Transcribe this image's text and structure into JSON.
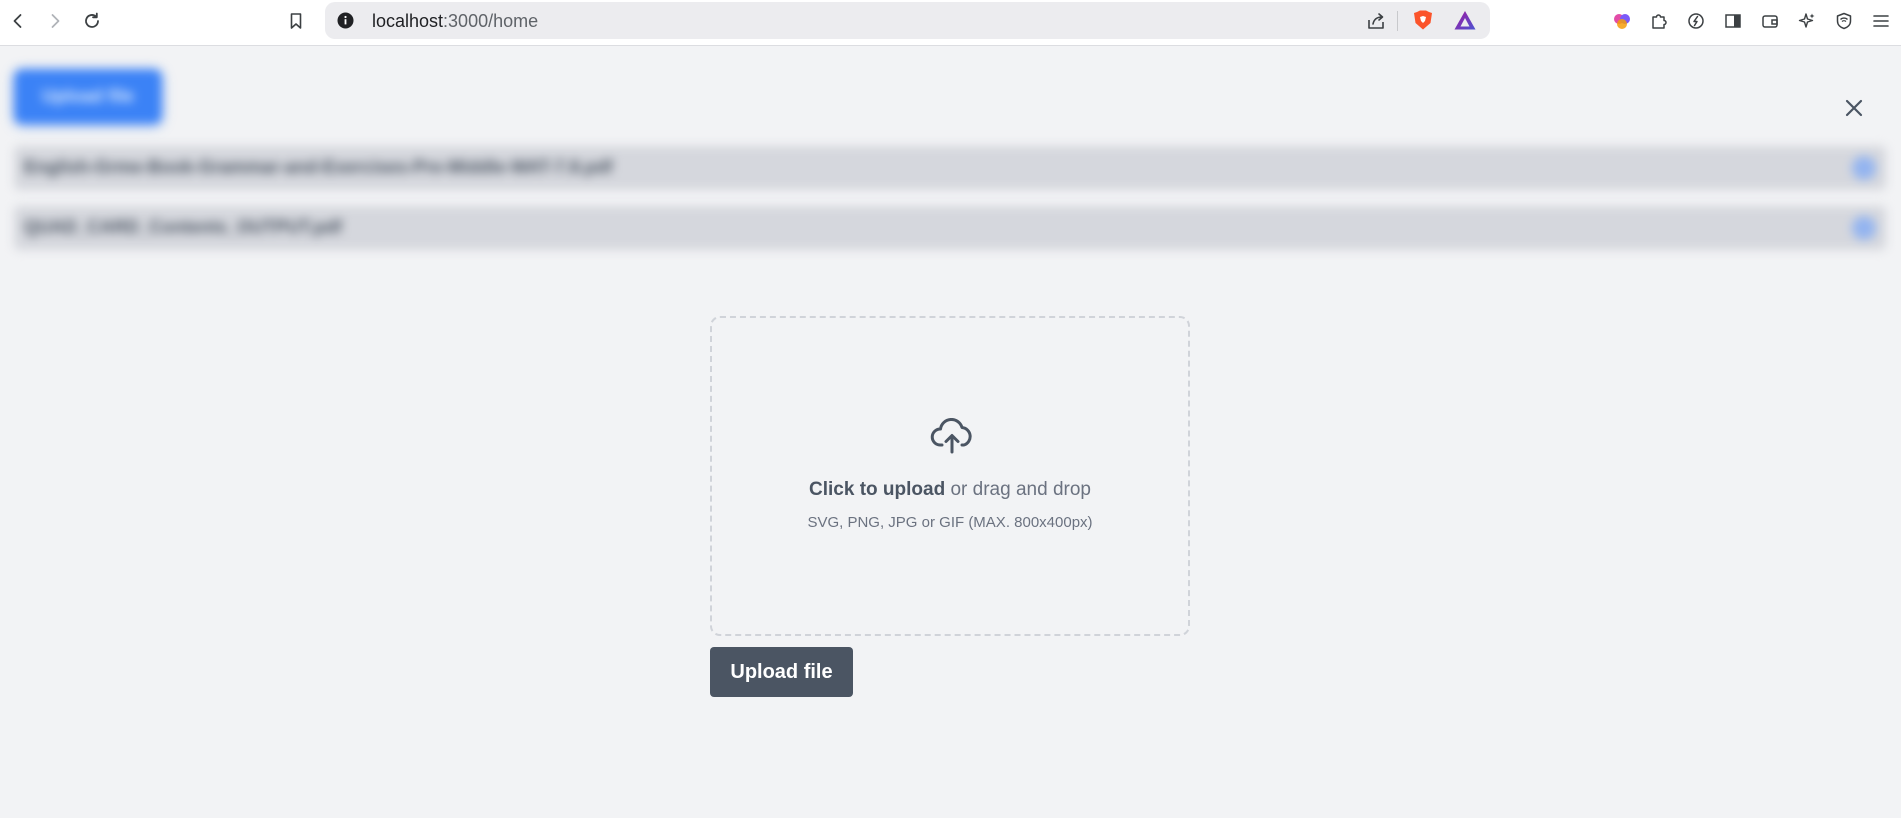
{
  "browser": {
    "url_host": "localhost",
    "url_rest": ":3000/home",
    "icons": {
      "back": "chevron-left-icon",
      "forward": "chevron-right-icon",
      "reload": "reload-icon",
      "bookmark": "bookmark-icon",
      "info": "info-icon",
      "share": "share-icon",
      "shields": "brave-shields-icon",
      "rewards": "brave-rewards-icon"
    },
    "extensions": [
      "leo-ai-icon",
      "puzzle-icon",
      "speedreader-icon",
      "sidebar-icon",
      "wallet-icon",
      "sparkle-icon",
      "vpn-shield-icon",
      "menu-icon"
    ]
  },
  "background": {
    "button_label": "Upload file",
    "rows": [
      "English-Grme-Book-Grammar-and-Exercises-Pre-Middle-WAT-7.8.pdf",
      "QUAD_CARD_Contents_OUTPUT.pdf"
    ]
  },
  "modal": {
    "close_icon": "close-icon",
    "dropzone": {
      "icon": "cloud-upload-icon",
      "cta_bold": "Click to upload",
      "cta_rest": " or drag and drop",
      "hint": "SVG, PNG, JPG or GIF (MAX. 800x400px)"
    },
    "upload_button": "Upload file"
  },
  "colors": {
    "page_bg": "#f2f3f5",
    "primary_blue": "#3b82f6",
    "upload_button_bg": "#4b5563",
    "dropzone_border": "#d0d3d9"
  }
}
